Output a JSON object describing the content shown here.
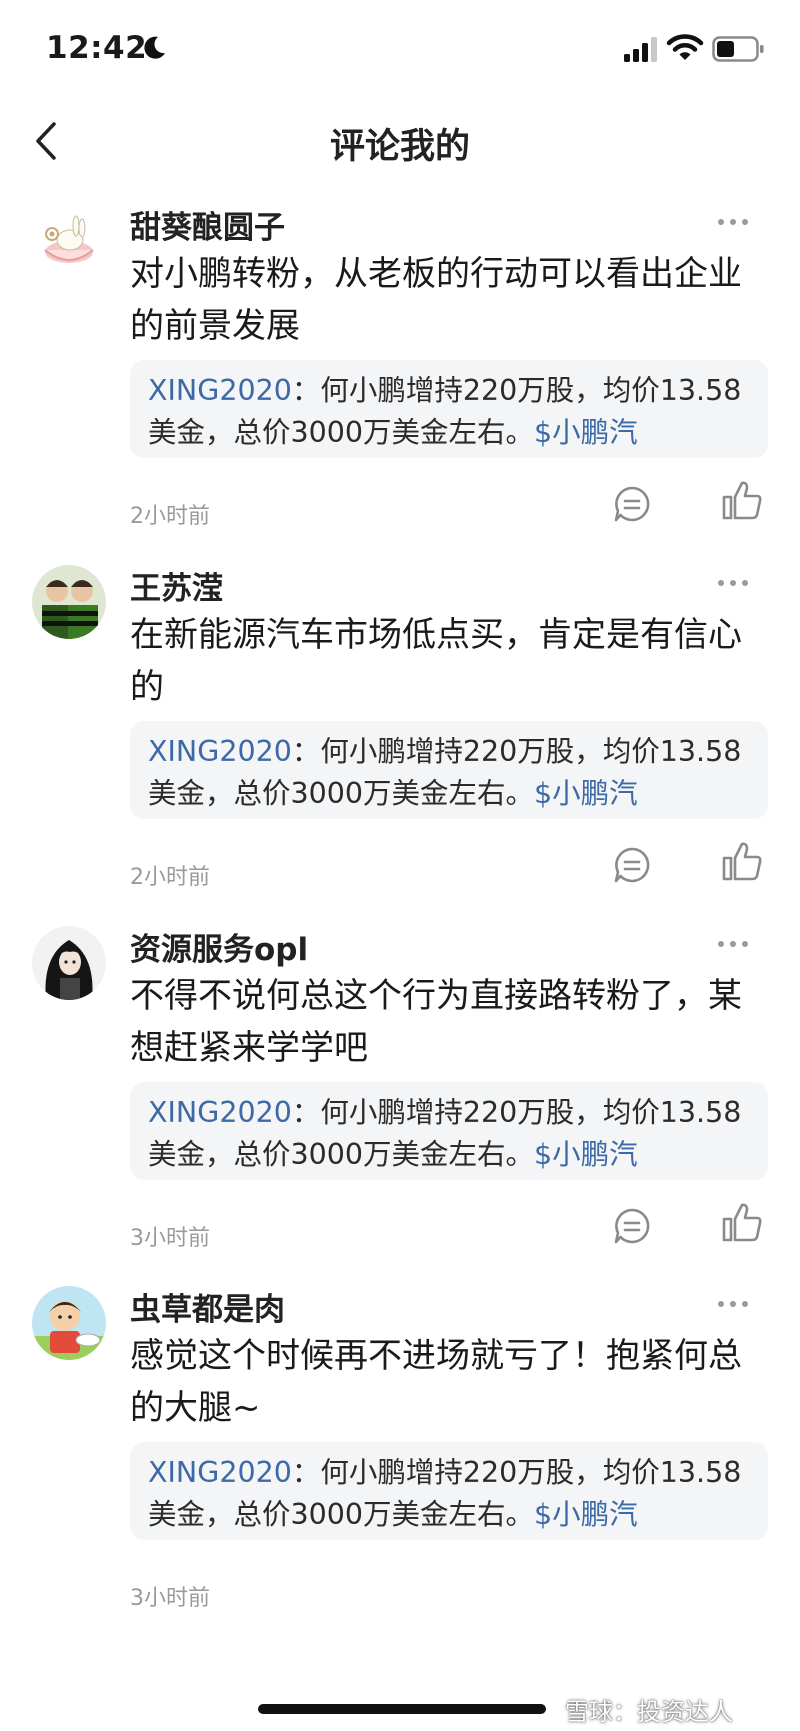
{
  "status_bar": {
    "time": "12:42"
  },
  "nav": {
    "title": "评论我的"
  },
  "comments": [
    {
      "username": "甜葵酿圆子",
      "content": "对小鹏转粉，从老板的行动可以看出企业的前景发展",
      "quote": {
        "author": "XING2020",
        "colon": "：",
        "text": "何小鹏增持220万股，均价13.58美金，总价3000万美金左右。",
        "stock": "$小鹏汽"
      },
      "timestamp": "2小时前"
    },
    {
      "username": "王苏滢",
      "content": "在新能源汽车市场低点买，肯定是有信心的",
      "quote": {
        "author": "XING2020",
        "colon": "：",
        "text": "何小鹏增持220万股，均价13.58美金，总价3000万美金左右。",
        "stock": "$小鹏汽"
      },
      "timestamp": "2小时前"
    },
    {
      "username": "资源服务opl",
      "content": "不得不说何总这个行为直接路转粉了，某想赶紧来学学吧",
      "quote": {
        "author": "XING2020",
        "colon": "：",
        "text": "何小鹏增持220万股，均价13.58美金，总价3000万美金左右。",
        "stock": "$小鹏汽"
      },
      "timestamp": "3小时前"
    },
    {
      "username": "虫草都是肉",
      "content": "感觉这个时候再不进场就亏了！抱紧何总的大腿~",
      "quote": {
        "author": "XING2020",
        "colon": "：",
        "text": "何小鹏增持220万股，均价13.58美金，总价3000万美金左右。",
        "stock": "$小鹏汽"
      },
      "timestamp": "3小时前"
    }
  ],
  "watermark": "雪球：投资达人"
}
